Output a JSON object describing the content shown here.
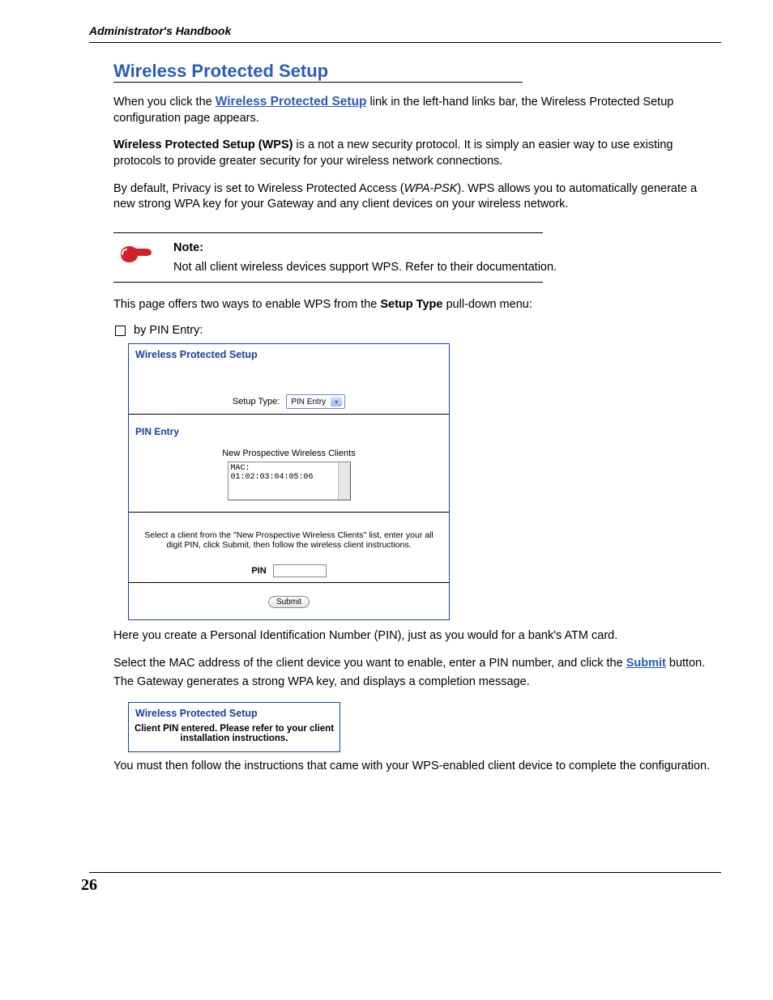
{
  "running_head": "Administrator's Handbook",
  "section_title": "Wireless Protected Setup",
  "intro": {
    "p1_a": "When you click the ",
    "p1_link": "Wireless Protected Setup",
    "p1_b": " link in the left-hand links bar, the Wireless Protected Setup configuration page appears.",
    "p2_bold": "Wireless Protected Setup (WPS)",
    "p2_rest": " is a not a new security protocol. It is simply an easier way to use existing protocols to provide greater security for your wireless network connections.",
    "p3_a": "By default, Privacy is set to Wireless Protected Access (",
    "p3_i": "WPA-PSK",
    "p3_b": "). WPS allows you to automatically generate a new strong WPA key for your Gateway and any client devices on your wireless network."
  },
  "note": {
    "label": "Note:",
    "body": "Not all client wireless devices support WPS. Refer to their documentation."
  },
  "p_after_note_a": "This page offers two ways to enable WPS from the ",
  "p_after_note_bold": "Setup Type",
  "p_after_note_b": " pull-down menu:",
  "bullet_pin": "by PIN Entry:",
  "panel1": {
    "title": "Wireless Protected Setup",
    "setup_type_label": "Setup Type:",
    "setup_type_value": "PIN Entry",
    "pin_entry_heading": "PIN Entry",
    "clients_heading": "New Prospective Wireless Clients",
    "clients": [
      "MAC: 01:02:03:04:05:06"
    ],
    "instruction": "Select a client from the \"New Prospective Wireless Clients\" list, enter your all digit PIN, click Submit, then follow the wireless client instructions.",
    "pin_label": "PIN",
    "pin_value": "",
    "submit_label": "Submit"
  },
  "after_panel": {
    "p1": "Here you create a Personal Identification Number (PIN), just as you would for a bank's ATM card.",
    "p2_a": "Select the MAC address of the client device you want to enable, enter a PIN number, and click the ",
    "p2_link": "Submit",
    "p2_b": " button.",
    "p3": "The Gateway generates a strong WPA key, and displays a completion message."
  },
  "panel2": {
    "title": "Wireless Protected Setup",
    "message": "Client PIN entered. Please refer to your client installation instructions."
  },
  "closing": "You must then follow the instructions that came with your WPS-enabled client device to complete the configuration.",
  "page_number": "26"
}
